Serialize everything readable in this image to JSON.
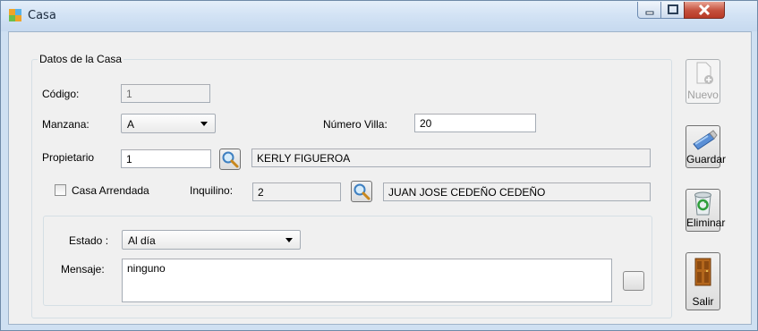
{
  "window": {
    "title": "Casa"
  },
  "datos": {
    "legend": "Datos de la Casa",
    "codigo_label": "Código:",
    "codigo_value": "1",
    "manzana_label": "Manzana:",
    "manzana_value": "A",
    "numero_villa_label": "Número Villa:",
    "numero_villa_value": "20",
    "propietario_label": "Propietario",
    "propietario_id": "1",
    "propietario_nombre": "KERLY FIGUEROA",
    "casa_arrendada_label": "Casa Arrendada",
    "casa_arrendada_checked": false,
    "inquilino_label": "Inquilino:",
    "inquilino_id": "2",
    "inquilino_nombre": "JUAN JOSE CEDEÑO CEDEÑO"
  },
  "estado": {
    "estado_label": "Estado :",
    "estado_value": "Al día",
    "mensaje_label": "Mensaje:",
    "mensaje_value": "ninguno"
  },
  "actions": {
    "nuevo_label": "Nuevo",
    "guardar_label": "Guardar",
    "eliminar_label": "Eliminar",
    "salir_label": "Salir"
  },
  "icons": {
    "app": "window-app-icon",
    "search": "magnifier-icon",
    "nuevo": "new-document-icon",
    "guardar": "usb-drive-icon",
    "eliminar": "recycle-bin-icon",
    "salir": "door-icon"
  },
  "colors": {
    "title_bar": "#d3e3f5",
    "close_button": "#c44f3c",
    "form_background": "#f0f0f0"
  }
}
